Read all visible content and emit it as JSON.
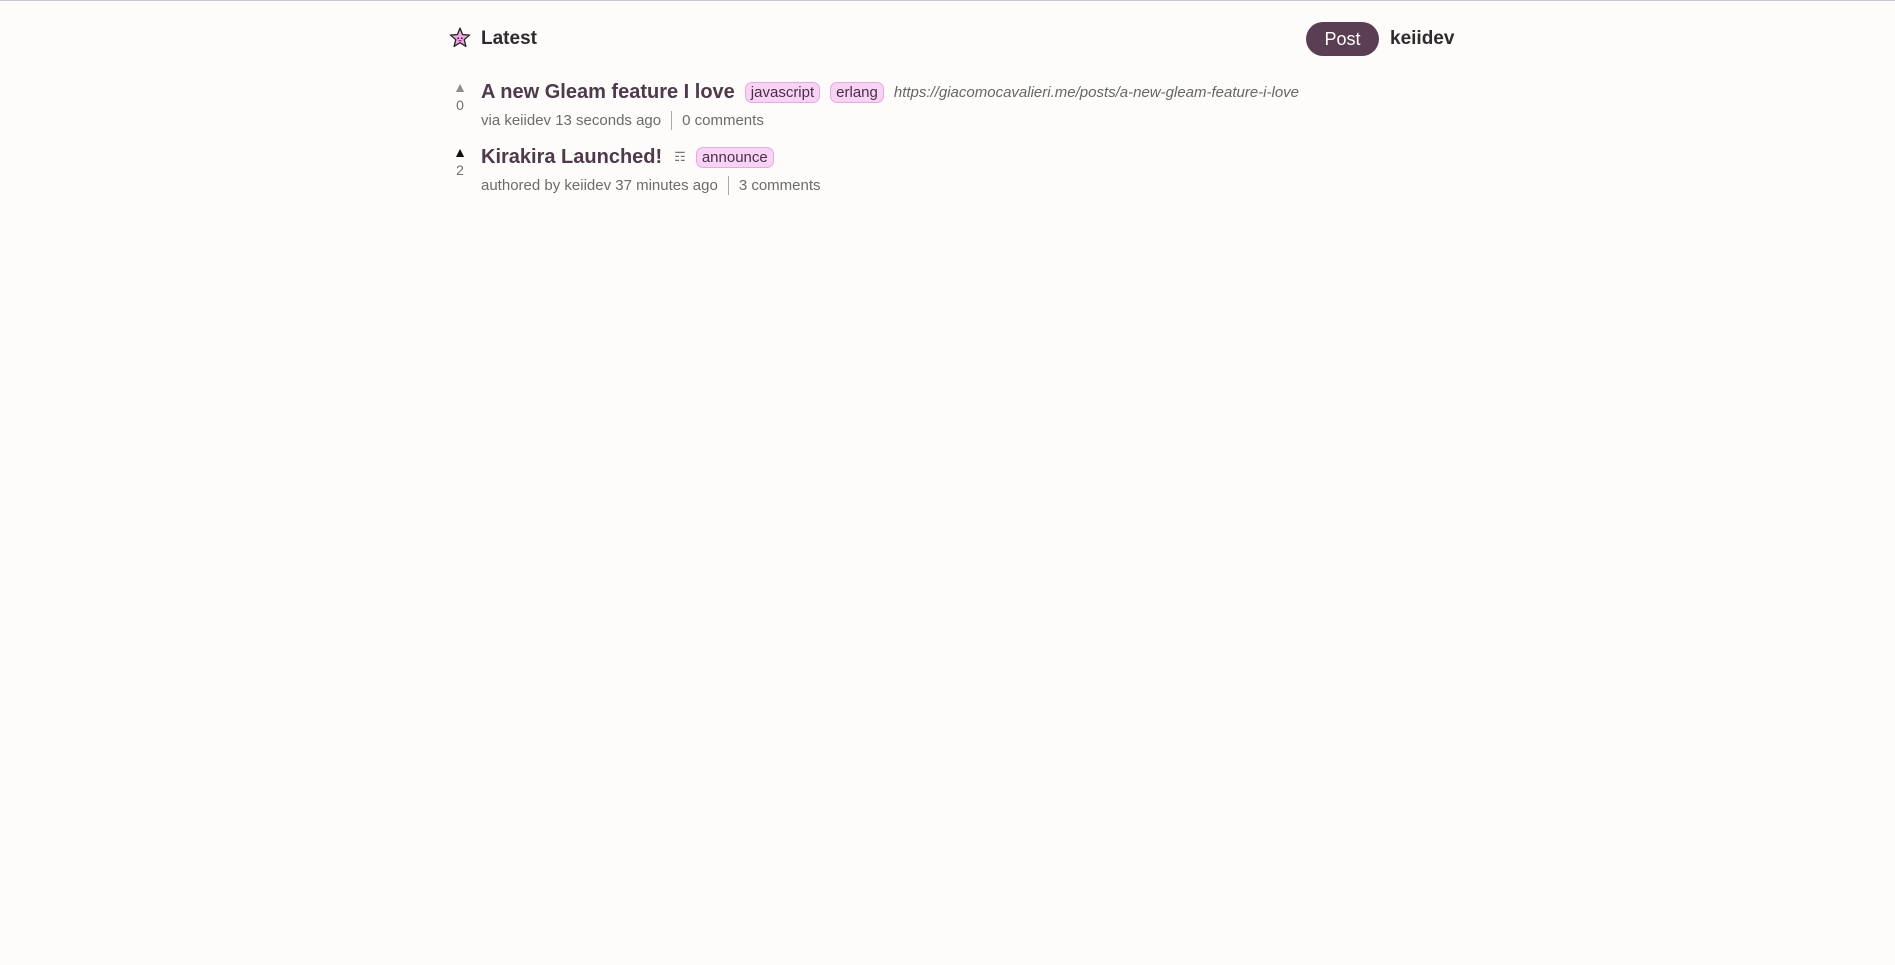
{
  "header": {
    "logo_icon": "star-logo-icon",
    "latest_label": "Latest",
    "post_button_label": "Post",
    "username": "keiidev"
  },
  "colors": {
    "accent": "#5a3e53",
    "tag_bg": "#f8d3f4",
    "title": "#4e3a4b"
  },
  "posts": [
    {
      "vote_icon": "upvote-arrow-icon",
      "vote_arrow": "▲",
      "votes": "0",
      "voted": false,
      "title": "A new Gleam feature I love",
      "tags": [
        "javascript",
        "erlang"
      ],
      "url": "https://giacomocavalieri.me/posts/a-new-gleam-feature-i-love",
      "meta": "via keiidev 13 seconds ago",
      "comments": "0 comments"
    },
    {
      "vote_icon": "upvote-arrow-icon",
      "vote_arrow": "▲",
      "votes": "2",
      "voted": true,
      "title": "Kirakira Launched!",
      "text_post_icon": "text-post-icon",
      "text_post_glyph": "☶",
      "tags": [
        "announce"
      ],
      "meta": "authored by keiidev 37 minutes ago",
      "comments": "3 comments"
    }
  ]
}
